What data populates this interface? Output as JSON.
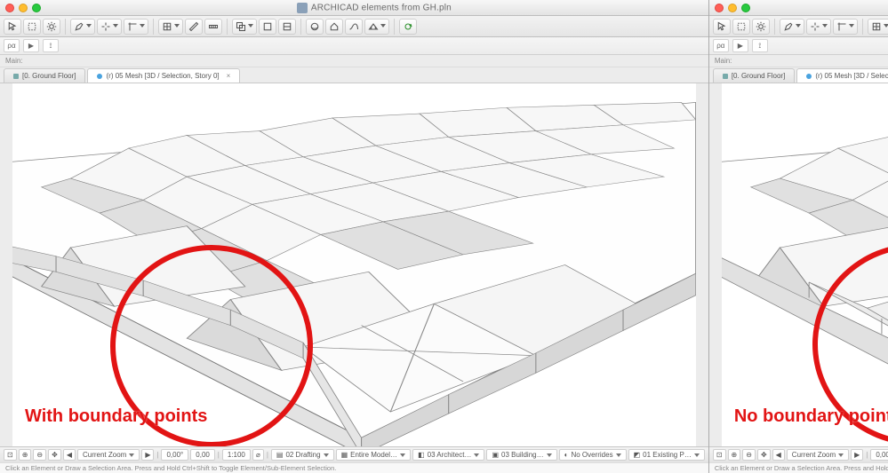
{
  "window_title": "ARCHICAD elements from GH.pln",
  "toolbar": {
    "arrow": "arrow",
    "marquee": "marquee",
    "sun": "sun",
    "edit": "edit",
    "snap": "snap",
    "grid": "grid",
    "measure": "measure",
    "ruler": "ruler",
    "trace": "trace",
    "box1": "box",
    "box2": "box",
    "orbit": "orbit",
    "home": "home",
    "curve": "curve",
    "perspective": "persp",
    "refresh": "refresh"
  },
  "sub_label": "Main:",
  "subbar": {
    "rho": "ρα",
    "play": "▶",
    "rruler": "⟟"
  },
  "tabs": [
    {
      "label": "[0. Ground Floor]",
      "kind": "plan",
      "active": false
    },
    {
      "label": "(r) 05 Mesh [3D / Selection, Story 0]",
      "kind": "3d",
      "active": true
    }
  ],
  "status": {
    "zoom_label": "Current Zoom",
    "zoom_arrow": "▸",
    "angle": "0,00°",
    "val2": "0,00",
    "scale": "1:100",
    "dpi": "⌀",
    "layer_combo": "02 Drafting",
    "model_view": "Entire Model…",
    "architect": "03 Architect…",
    "building": "03 Building…",
    "overrides": "No Overrides",
    "existing": "01 Existing P…"
  },
  "hint": "Click an Element or Draw a Selection Area. Press and Hold Ctrl+Shift to Toggle Element/Sub-Element Selection.",
  "annotations": {
    "left": "With boundary points",
    "right": "No boundary points added"
  }
}
